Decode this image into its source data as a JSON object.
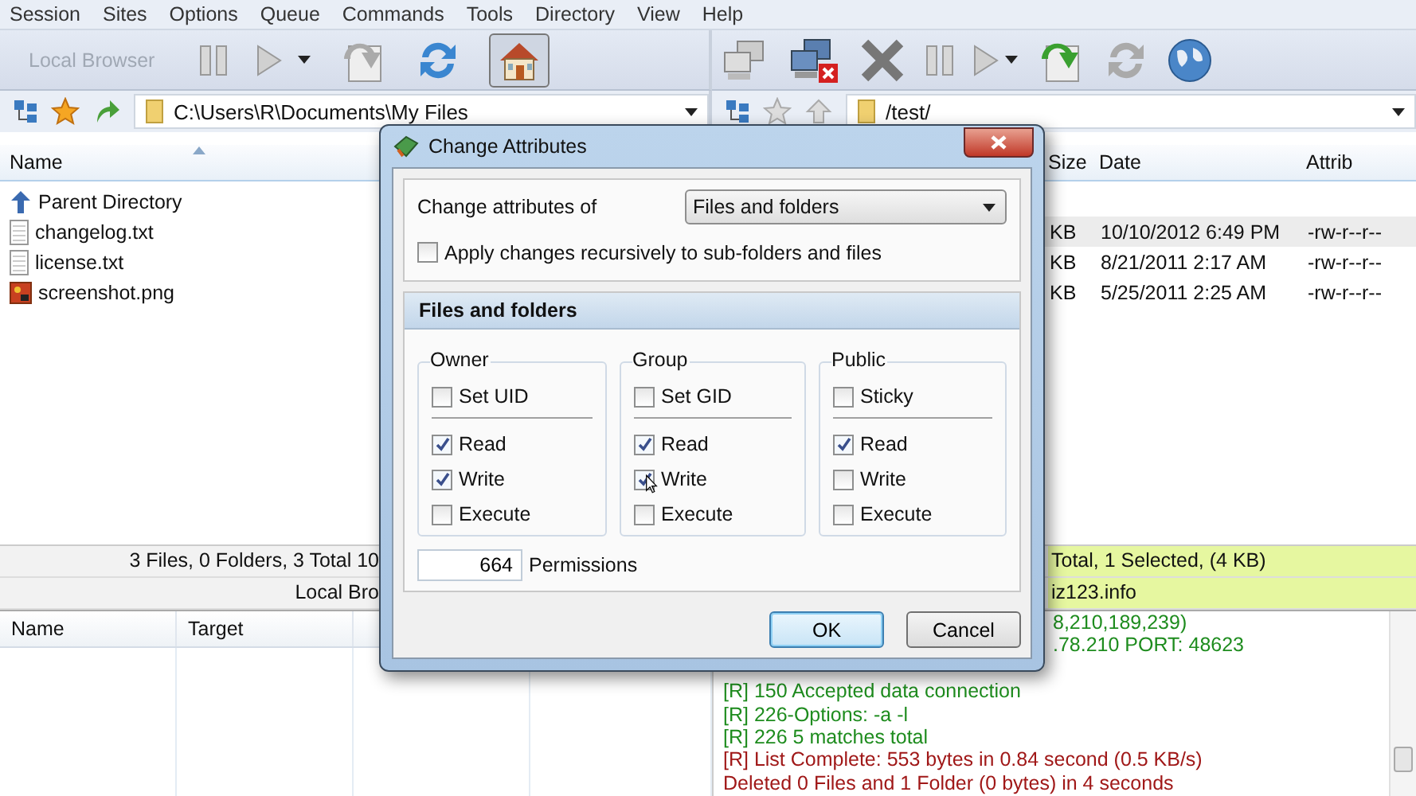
{
  "menu": [
    "Session",
    "Sites",
    "Options",
    "Queue",
    "Commands",
    "Tools",
    "Directory",
    "View",
    "Help"
  ],
  "local": {
    "toolbar_label": "Local Browser",
    "path": "C:\\Users\\R\\Documents\\My Files",
    "column": "Name",
    "files": [
      {
        "name": "Parent Directory",
        "kind": "up"
      },
      {
        "name": "changelog.txt",
        "kind": "text"
      },
      {
        "name": "license.txt",
        "kind": "text"
      },
      {
        "name": "screenshot.png",
        "kind": "image"
      }
    ],
    "status": "3 Files, 0 Folders, 3 Total 10",
    "label": "Local Bro"
  },
  "remote": {
    "path": "/test/",
    "columns": [
      "Size",
      "Date",
      "Attrib"
    ],
    "files": [
      {
        "size": "KB",
        "date": "10/10/2012 6:49 PM",
        "attrib": "-rw-r--r--",
        "selected": true
      },
      {
        "size": "KB",
        "date": "8/21/2011 2:17 AM",
        "attrib": "-rw-r--r--",
        "selected": false
      },
      {
        "size": "KB",
        "date": "5/25/2011 2:25 AM",
        "attrib": "-rw-r--r--",
        "selected": false
      }
    ],
    "status": "Total, 1 Selected, (4 KB)",
    "label": "iz123.info"
  },
  "queue": {
    "columns": [
      "Name",
      "Target"
    ]
  },
  "log": {
    "cut_lines": [
      {
        "text": "8,210,189,239)",
        "color": "#1e8c1e"
      },
      {
        "text": ".78.210 PORT: 48623",
        "color": "#1e8c1e"
      }
    ],
    "lines": [
      {
        "text": "[R] 150 Accepted data connection",
        "color": "#1e8c1e"
      },
      {
        "text": "[R] 226-Options: -a -l",
        "color": "#1e8c1e"
      },
      {
        "text": "[R] 226 5 matches total",
        "color": "#1e8c1e"
      },
      {
        "text": "[R] List Complete: 553 bytes in 0.84 second (0.5 KB/s)",
        "color": "#a01818"
      },
      {
        "text": "Deleted 0 Files and 1 Folder (0 bytes) in 4 seconds",
        "color": "#a01818"
      }
    ]
  },
  "dialog": {
    "title": "Change Attributes",
    "target_label": "Change attributes of",
    "target_value": "Files and folders",
    "recursive": {
      "label": "Apply changes recursively to sub-folders and files",
      "checked": false
    },
    "section": "Files and folders",
    "groups": [
      {
        "title": "Owner",
        "special": {
          "label": "Set UID",
          "checked": false
        },
        "perms": [
          {
            "label": "Read",
            "checked": true
          },
          {
            "label": "Write",
            "checked": true
          },
          {
            "label": "Execute",
            "checked": false
          }
        ]
      },
      {
        "title": "Group",
        "special": {
          "label": "Set GID",
          "checked": false
        },
        "perms": [
          {
            "label": "Read",
            "checked": true
          },
          {
            "label": "Write",
            "checked": true
          },
          {
            "label": "Execute",
            "checked": false
          }
        ]
      },
      {
        "title": "Public",
        "special": {
          "label": "Sticky",
          "checked": false
        },
        "perms": [
          {
            "label": "Read",
            "checked": true
          },
          {
            "label": "Write",
            "checked": false
          },
          {
            "label": "Execute",
            "checked": false
          }
        ]
      }
    ],
    "permissions_value": "664",
    "permissions_label": "Permissions",
    "buttons": [
      {
        "label": "OK",
        "selected": true
      },
      {
        "label": "Cancel",
        "selected": false
      }
    ]
  }
}
